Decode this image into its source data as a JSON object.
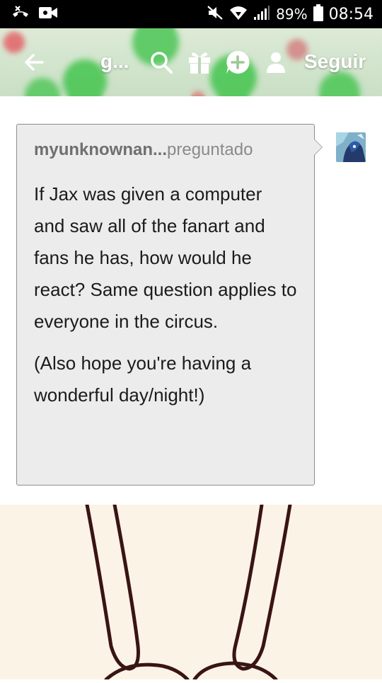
{
  "status_bar": {
    "battery_text": "89%",
    "time": "08:54",
    "icons": [
      "missed-call-icon",
      "video-call-icon",
      "mute-icon",
      "wifi-icon",
      "signal-icon",
      "battery-icon"
    ]
  },
  "header": {
    "blog_title": "g...",
    "follow_label": "Seguir",
    "icons": [
      "back-arrow-icon",
      "search-icon",
      "gift-icon",
      "add-circle-icon",
      "person-icon"
    ]
  },
  "ask": {
    "asker_name": "myunknownan...",
    "asked_label": "preguntado",
    "paragraphs": [
      "If Jax was given a computer and saw all of the fanart and fans he has, how would he react? Same question applies to everyone in the circus.",
      "(Also hope you're having a wonderful day/night!)"
    ]
  },
  "colors": {
    "bubble_bg": "#ececec",
    "bubble_border": "#8e8e8e",
    "drawing_bg": "#fbf4e6",
    "drawing_line": "#3a1414"
  }
}
